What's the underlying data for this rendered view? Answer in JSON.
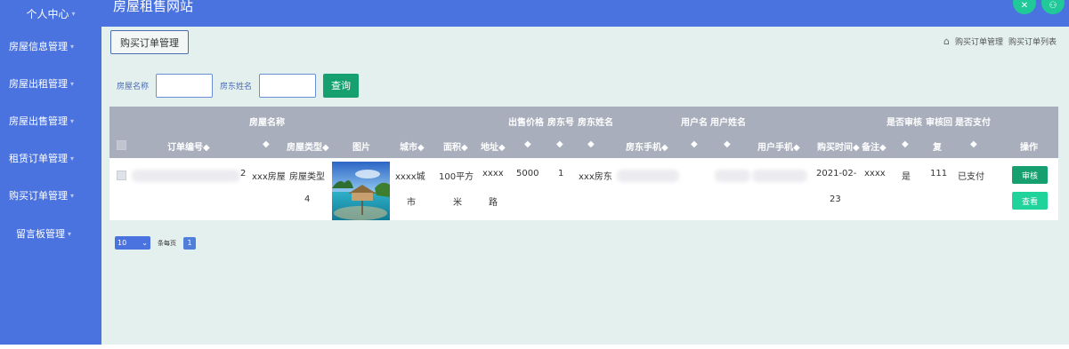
{
  "topbar": {
    "user_center": "个人中心",
    "site_title": "房屋租售网站",
    "accent": "#4a73e0"
  },
  "sidebar": {
    "items": [
      {
        "label": "房屋信息管理"
      },
      {
        "label": "房屋出租管理"
      },
      {
        "label": "房屋出售管理"
      },
      {
        "label": "租赁订单管理"
      },
      {
        "label": "购买订单管理"
      },
      {
        "label": "留言板管理"
      }
    ]
  },
  "main": {
    "tab_label": "购买订单管理",
    "breadcrumb": [
      "购买订单管理",
      "购买订单列表"
    ],
    "search": {
      "house_name_label": "房屋名称",
      "owner_name_label": "房东姓名",
      "query_label": "查询"
    },
    "table": {
      "group_headers": {
        "house_name": "房屋名称",
        "sale_price": "出售价格",
        "owner_no": "房东号",
        "owner_name": "房东姓名",
        "username": "用户名",
        "user_realname": "用户姓名",
        "is_reviewed": "是否审核",
        "review_reply": "审核回",
        "is_paid": "是否支付"
      },
      "headers": {
        "order_no": "订单编号",
        "house_type": "房屋类型",
        "image": "图片",
        "city": "城市",
        "area": "面积",
        "address": "地址",
        "owner_phone": "房东手机",
        "user_phone": "用户手机",
        "purchase_time": "购买时间",
        "remark": "备注",
        "reply": "复",
        "action": "操作"
      },
      "sort_mark": "◆",
      "row": {
        "order_no_tail": "2",
        "house_name": "xxx房屋",
        "house_type_line1": "房屋类型",
        "house_type_line2": "4",
        "city_line1": "xxxx城",
        "city_line2": "市",
        "area_line1": "100平方",
        "area_line2": "米",
        "address_line1": "xxxx",
        "address_line2": "路",
        "sale_price": "5000",
        "owner_no": "1",
        "owner_name": "xxx房东",
        "purchase_time_line1": "2021-02-",
        "purchase_time_line2": "23",
        "remark": "xxxx",
        "is_reviewed": "是",
        "review_reply": "111",
        "is_paid": "已支付",
        "review_btn": "审核",
        "view_btn": "查看"
      }
    },
    "pager": {
      "page_size": "10",
      "per_page_label": "条每页",
      "current_page": "1"
    }
  }
}
